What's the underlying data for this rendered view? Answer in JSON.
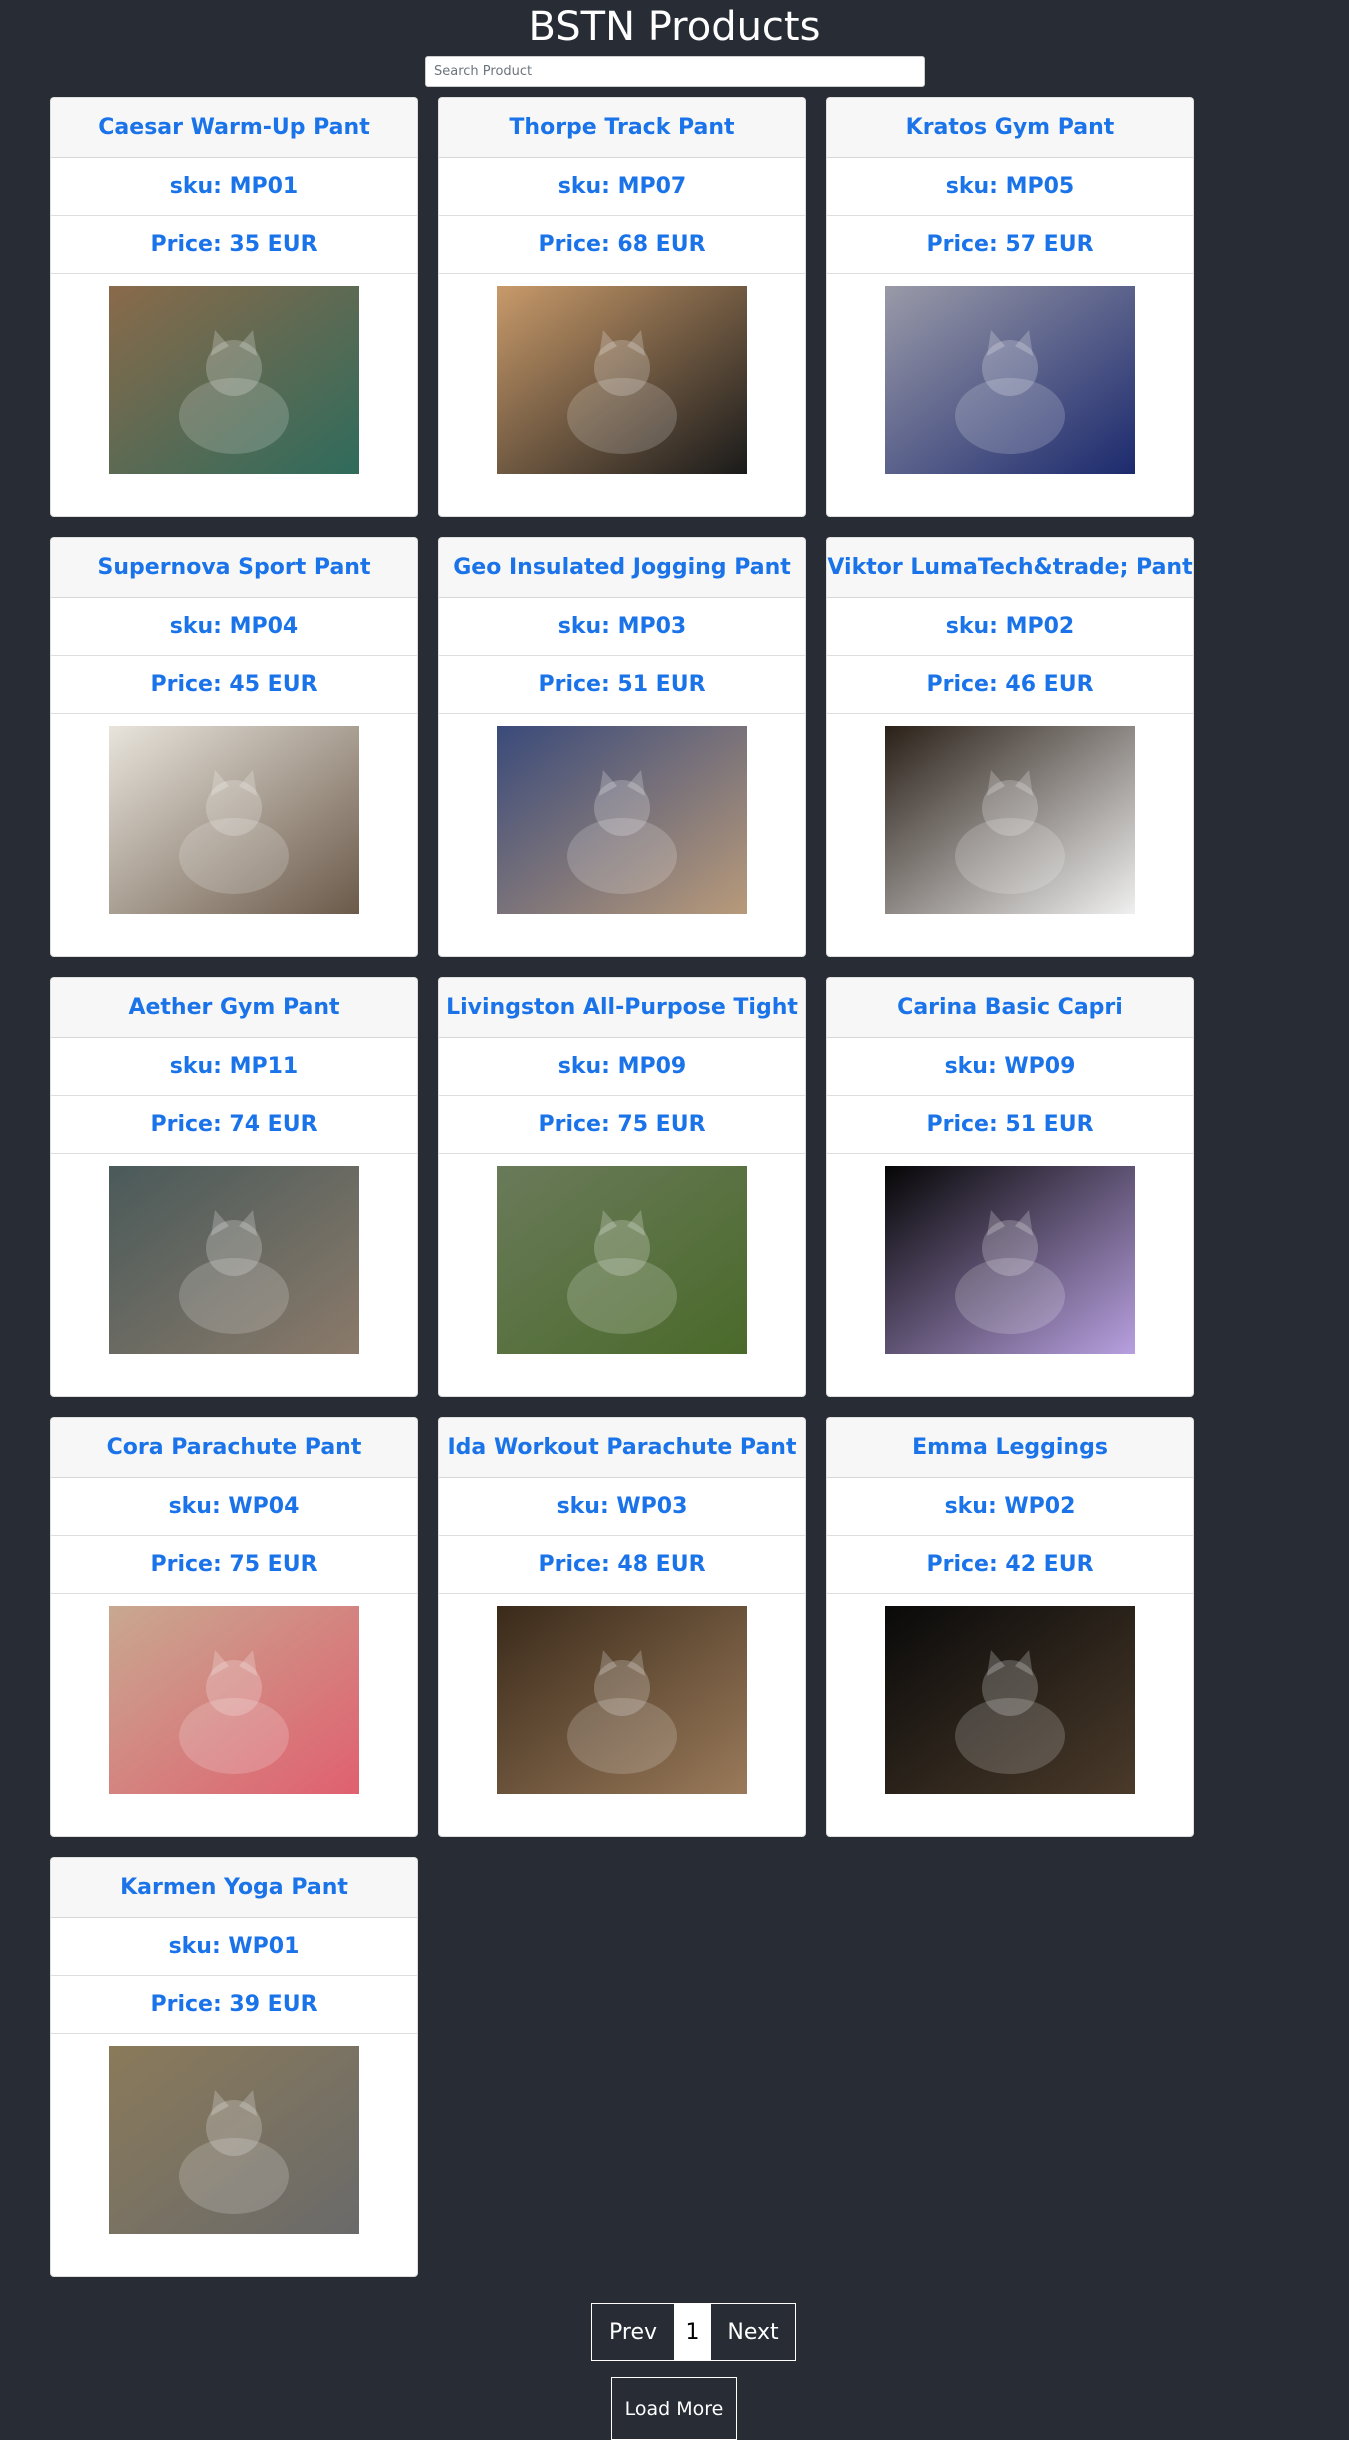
{
  "header": {
    "title": "BSTN Products"
  },
  "search": {
    "placeholder": "Search Product"
  },
  "products": [
    {
      "name": "Caesar Warm-Up Pant",
      "sku": "sku: MP01",
      "price": "Price: 35 EUR",
      "image_caption": "Cat photo",
      "colors": [
        "#8a6a4a",
        "#2f6b5c"
      ]
    },
    {
      "name": "Thorpe Track Pant",
      "sku": "sku: MP07",
      "price": "Price: 68 EUR",
      "image_caption": "Cat photo",
      "colors": [
        "#c89a6a",
        "#1a1a1a"
      ]
    },
    {
      "name": "Kratos Gym Pant",
      "sku": "sku: MP05",
      "price": "Price: 57 EUR",
      "image_caption": "Cat photo",
      "colors": [
        "#9a9aa8",
        "#1c2a6e"
      ]
    },
    {
      "name": "Supernova Sport Pant",
      "sku": "sku: MP04",
      "price": "Price: 45 EUR",
      "image_caption": "Cat photo",
      "colors": [
        "#e8e4dc",
        "#6b5a4a"
      ]
    },
    {
      "name": "Geo Insulated Jogging Pant",
      "sku": "sku: MP03",
      "price": "Price: 51 EUR",
      "image_caption": "Cat photo",
      "colors": [
        "#3a4a7a",
        "#b89a7a"
      ]
    },
    {
      "name": "Viktor LumaTech&trade; Pant",
      "sku": "sku: MP02",
      "price": "Price: 46 EUR",
      "image_caption": "Cat photo",
      "colors": [
        "#2a2018",
        "#f0f0f0"
      ]
    },
    {
      "name": "Aether Gym Pant",
      "sku": "sku: MP11",
      "price": "Price: 74 EUR",
      "image_caption": "Cat photo",
      "colors": [
        "#4a5a5a",
        "#8a7a6a"
      ]
    },
    {
      "name": "Livingston All-Purpose Tight",
      "sku": "sku: MP09",
      "price": "Price: 75 EUR",
      "image_caption": "Cat photo",
      "colors": [
        "#6a7a5a",
        "#4a6a2a"
      ]
    },
    {
      "name": "Carina Basic Capri",
      "sku": "sku: WP09",
      "price": "Price: 51 EUR",
      "image_caption": "Cat photo",
      "colors": [
        "#050505",
        "#b8a0e0"
      ]
    },
    {
      "name": "Cora Parachute Pant",
      "sku": "sku: WP04",
      "price": "Price: 75 EUR",
      "image_caption": "Cat photo",
      "colors": [
        "#c8a890",
        "#e06070"
      ]
    },
    {
      "name": "Ida Workout Parachute Pant",
      "sku": "sku: WP03",
      "price": "Price: 48 EUR",
      "image_caption": "Cat photo",
      "colors": [
        "#3a2a1a",
        "#9a7a5a"
      ]
    },
    {
      "name": "Emma Leggings",
      "sku": "sku: WP02",
      "price": "Price: 42 EUR",
      "image_caption": "Cat photo",
      "colors": [
        "#0a0a0a",
        "#4a3a2a"
      ]
    },
    {
      "name": "Karmen Yoga Pant",
      "sku": "sku: WP01",
      "price": "Price: 39 EUR",
      "image_caption": "Cat photo",
      "colors": [
        "#8a7a5a",
        "#6a6a6a"
      ]
    }
  ],
  "pagination": {
    "prev": "Prev",
    "page": "1",
    "next": "Next"
  },
  "load_more": {
    "label": "Load More"
  }
}
